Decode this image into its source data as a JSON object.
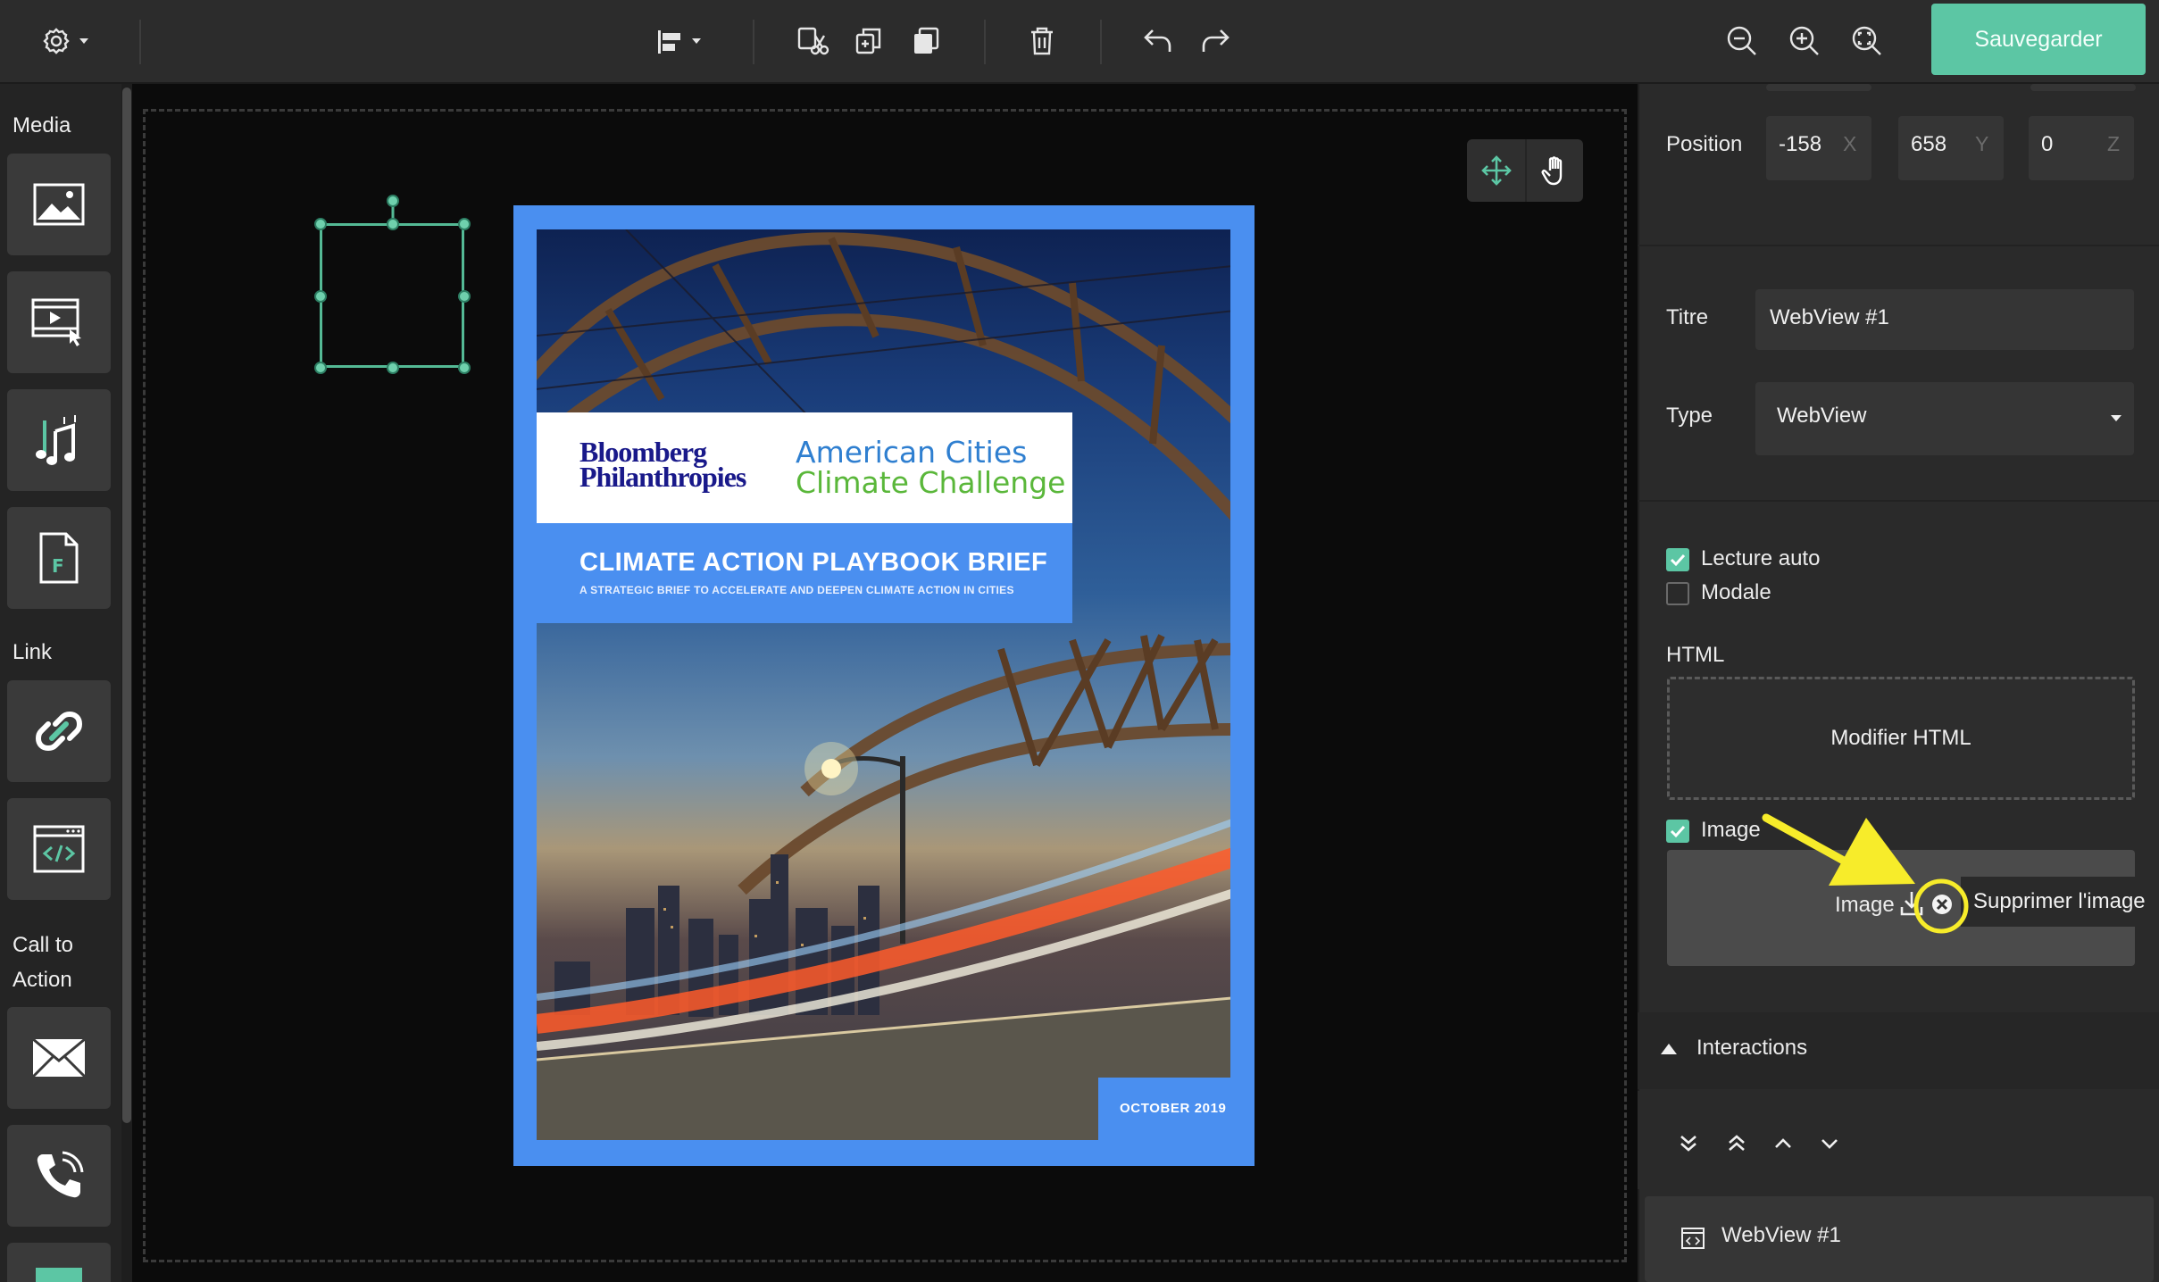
{
  "toolbar": {
    "settings_icon": "gear-icon",
    "align_icon": "align-left-icon",
    "cut_icon": "scissors-icon",
    "copy_icon": "copy-icon",
    "paste_icon": "paste-icon",
    "delete_icon": "trash-icon",
    "undo_icon": "undo-icon",
    "redo_icon": "redo-icon",
    "zoom_out_icon": "zoom-out-icon",
    "zoom_in_icon": "zoom-in-icon",
    "zoom_fit_icon": "zoom-fit-icon",
    "save_label": "Sauvegarder"
  },
  "sidebar": {
    "sections": {
      "media": "Media",
      "link": "Link",
      "cta_line1": "Call to",
      "cta_line2": "Action"
    },
    "tiles": [
      "image-icon",
      "video-icon",
      "audio-icon",
      "form-icon",
      "link-icon",
      "webview-icon",
      "email-icon",
      "phone-icon"
    ]
  },
  "canvas": {
    "move_tool_icon": "move-icon",
    "hand_tool_icon": "hand-icon"
  },
  "cover": {
    "logo_bloomberg_line1": "Bloomberg",
    "logo_bloomberg_line2": "Philanthropies",
    "logo_acc_line1": "American Cities",
    "logo_acc_line2": "Climate Challenge",
    "title": "CLIMATE ACTION PLAYBOOK BRIEF",
    "subtitle": "A STRATEGIC BRIEF TO ACCELERATE AND DEEPEN CLIMATE ACTION IN CITIES",
    "date": "OCTOBER 2019"
  },
  "panel": {
    "position_label": "Position",
    "pos_x": "-158",
    "pos_x_axis": "X",
    "pos_y": "658",
    "pos_y_axis": "Y",
    "pos_z": "0",
    "pos_z_axis": "Z",
    "title_label": "Titre",
    "title_value": "WebView #1",
    "type_label": "Type",
    "type_value": "WebView",
    "autoplay_label": "Lecture auto",
    "autoplay_checked": true,
    "modal_label": "Modale",
    "modal_checked": false,
    "html_label": "HTML",
    "edit_html_label": "Modifier HTML",
    "image_label": "Image",
    "image_checked": true,
    "image_field_label": "Image",
    "delete_image_tooltip": "Supprimer l'image",
    "interactions_label": "Interactions",
    "layer_name": "WebView #1"
  },
  "colors": {
    "accent": "#5cc6a4",
    "cover_blue": "#4a8ff0",
    "annotation_yellow": "#f7ec2a"
  }
}
